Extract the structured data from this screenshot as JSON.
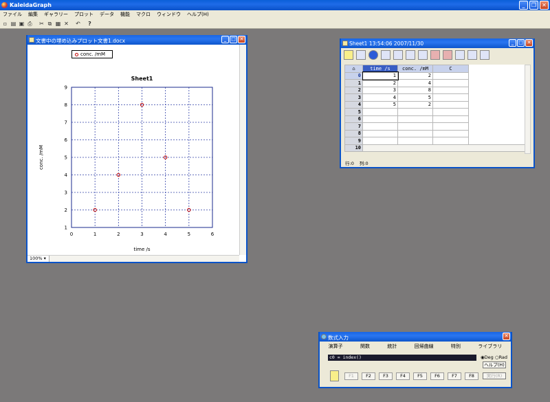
{
  "app": {
    "title": "KaleidaGraph"
  },
  "menu": [
    "ファイル",
    "編集",
    "ギャラリー",
    "プロット",
    "データ",
    "機能",
    "マクロ",
    "ウィンドウ",
    "ヘルプ(H)"
  ],
  "toolbar_icons": [
    "new-doc-icon",
    "open-folder-icon",
    "save-icon",
    "print-icon",
    "cut-icon",
    "copy-icon",
    "paste-icon",
    "clear-icon",
    "undo-icon",
    "help-icon"
  ],
  "graph_window": {
    "title": "文書中の埋め込みプロット文書1.docx",
    "zoom": "100%",
    "legend": "conc. /mM"
  },
  "chart_data": {
    "type": "scatter",
    "title": "Sheet1",
    "xlabel": "time /s",
    "ylabel": "conc. /mM",
    "xlim": [
      0,
      6
    ],
    "ylim": [
      1,
      9
    ],
    "xticks": [
      0,
      1,
      2,
      3,
      4,
      5,
      6
    ],
    "yticks": [
      1,
      2,
      3,
      4,
      5,
      6,
      7,
      8,
      9
    ],
    "grid": true,
    "series": [
      {
        "name": "conc. /mM",
        "x": [
          1,
          2,
          3,
          4,
          5
        ],
        "y": [
          2,
          4,
          8,
          5,
          2
        ],
        "color": "#c00000"
      }
    ]
  },
  "sheet_window": {
    "title": "Sheet1 13:54:06  2007/11/30",
    "columns": [
      "time /s",
      "conc. /mM",
      "C"
    ],
    "row_numbers": [
      "0",
      "1",
      "2",
      "3",
      "4",
      "5",
      "6",
      "7",
      "8",
      "9",
      "10"
    ],
    "rows": [
      [
        "1",
        "2",
        ""
      ],
      [
        "2",
        "4",
        ""
      ],
      [
        "3",
        "8",
        ""
      ],
      [
        "4",
        "5",
        ""
      ],
      [
        "5",
        "2",
        ""
      ],
      [
        "",
        "",
        ""
      ],
      [
        "",
        "",
        ""
      ],
      [
        "",
        "",
        ""
      ],
      [
        "",
        "",
        ""
      ],
      [
        "",
        "",
        ""
      ]
    ],
    "footer": [
      "行:0",
      "列:0"
    ]
  },
  "formula_window": {
    "title": "数式入力",
    "tabs": [
      "演算子",
      "関数",
      "統計",
      "回帰曲線",
      "特別",
      "ライブラリ"
    ],
    "formula": "c0 = index()",
    "deg": "Deg",
    "rad": "Rad",
    "help": "ヘルプ(H)",
    "fkeys": [
      "F1",
      "F2",
      "F3",
      "F4",
      "F5",
      "F6",
      "F7",
      "F8"
    ],
    "run": "実行(R)"
  }
}
